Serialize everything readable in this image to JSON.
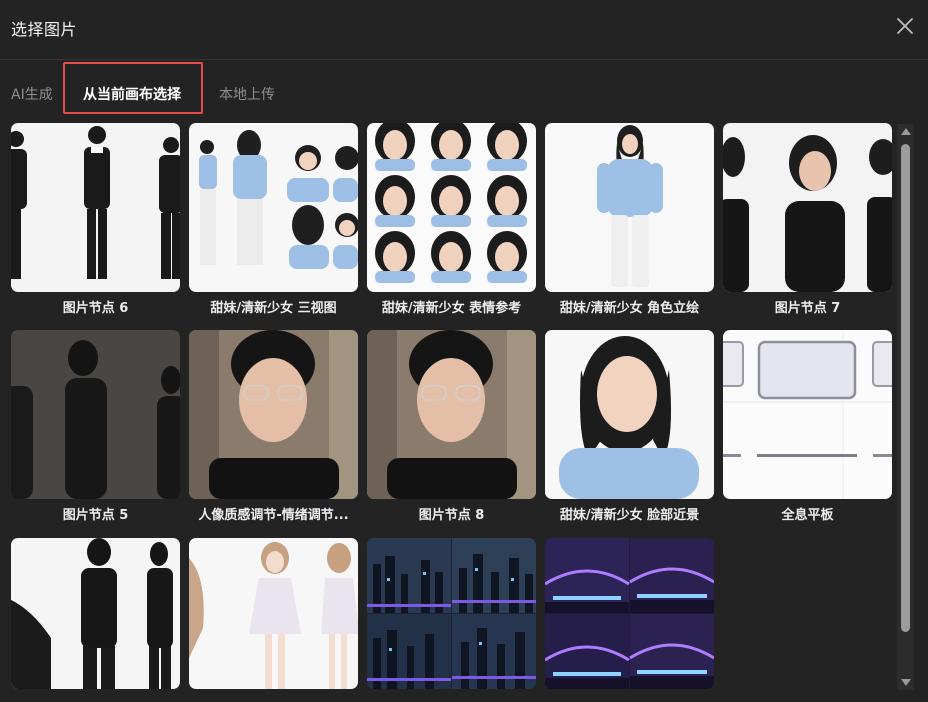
{
  "dialog": {
    "title": "选择图片",
    "close_icon": "close-icon"
  },
  "tabs": [
    {
      "label": "AI生成",
      "active": false
    },
    {
      "label": "从当前画布选择",
      "active": true
    },
    {
      "label": "本地上传",
      "active": false
    }
  ],
  "images": [
    {
      "label": "图片节点 6",
      "thumbnail": "man-black-suit-turnaround"
    },
    {
      "label": "甜妹/清新少女 三视图",
      "thumbnail": "girl-three-views"
    },
    {
      "label": "甜妹/清新少女 表情参考",
      "thumbnail": "girl-expression-grid"
    },
    {
      "label": "甜妹/清新少女 角色立绘",
      "thumbnail": "girl-full-body"
    },
    {
      "label": "图片节点 7",
      "thumbnail": "man-profile-suit"
    },
    {
      "label": "图片节点 5",
      "thumbnail": "man-back-turnaround"
    },
    {
      "label": "人像质感调节-情绪调节...",
      "thumbnail": "man-glasses-portrait"
    },
    {
      "label": "图片节点 8",
      "thumbnail": "man-glasses-portrait"
    },
    {
      "label": "甜妹/清新少女 脸部近景",
      "thumbnail": "girl-face-closeup"
    },
    {
      "label": "全息平板",
      "thumbnail": "holographic-tablet"
    },
    {
      "label": "",
      "thumbnail": "man-suit-full-body"
    },
    {
      "label": "",
      "thumbnail": "girl-white-dress"
    },
    {
      "label": "",
      "thumbnail": "city-night-grid"
    },
    {
      "label": "",
      "thumbnail": "purple-scifi-interior"
    }
  ]
}
